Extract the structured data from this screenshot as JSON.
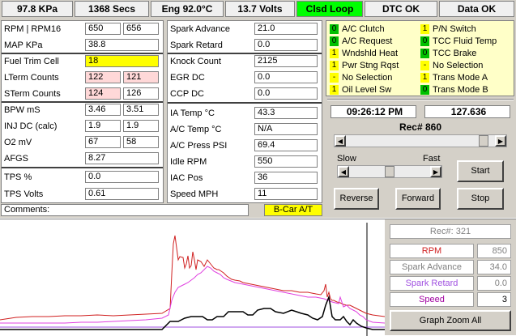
{
  "topbar": {
    "kpa": "97.8 KPa",
    "secs": "1368 Secs",
    "eng_temp": "Eng  92.0°C",
    "volts": "13.7 Volts",
    "loop": "Clsd Loop",
    "dtc": "DTC OK",
    "data": "Data OK"
  },
  "left": {
    "rpm_label": "RPM   |  RPM16",
    "rpm_v1": "650",
    "rpm_v2": "656",
    "map_label": "MAP KPa",
    "map_v": "38.8",
    "fuel_label": "Fuel Trim Cell",
    "fuel_v": "18",
    "lterm_label": "LTerm Counts",
    "lterm_v1": "122",
    "lterm_v2": "121",
    "sterm_label": "STerm Counts",
    "sterm_v1": "124",
    "sterm_v2": "126",
    "bpw_label": "BPW  mS",
    "bpw_v1": "3.46",
    "bpw_v2": "3.51",
    "inj_label": "INJ DC (calc)",
    "inj_v1": "1.9",
    "inj_v2": "1.9",
    "o2_label": "O2 mV",
    "o2_v1": "67",
    "o2_v2": "58",
    "afgs_label": "AFGS",
    "afgs_v": "8.27",
    "tps_label": "TPS %",
    "tps_v": "0.0",
    "tpsv_label": "TPS Volts",
    "tpsv_v": "0.61"
  },
  "mid": {
    "spark_adv_label": "Spark Advance",
    "spark_adv_v": "21.0",
    "spark_ret_label": "Spark Retard",
    "spark_ret_v": "0.0",
    "knock_label": "Knock Count",
    "knock_v": "2125",
    "egr_label": "EGR DC",
    "egr_v": "0.0",
    "ccp_label": "CCP DC",
    "ccp_v": "0.0",
    "ia_label": "IA Temp °C",
    "ia_v": "43.3",
    "ac_temp_label": "A/C Temp °C",
    "ac_temp_v": "N/A",
    "ac_press_label": "A/C Press PSI",
    "ac_press_v": "69.4",
    "idle_label": "Idle RPM",
    "idle_v": "550",
    "iac_label": "IAC Pos",
    "iac_v": "36",
    "speed_label": "Speed MPH",
    "speed_v": "11"
  },
  "comments": {
    "label": "Comments:",
    "tag": "B-Car A/T"
  },
  "indicators": [
    {
      "val": "0",
      "label": "A/C Clutch",
      "state": "off"
    },
    {
      "val": "1",
      "label": "P/N Switch",
      "state": "on"
    },
    {
      "val": "0",
      "label": "A/C Request",
      "state": "off"
    },
    {
      "val": "0",
      "label": "TCC Fluid Temp",
      "state": "off"
    },
    {
      "val": "1",
      "label": "Wndshld Heat",
      "state": "on"
    },
    {
      "val": "0",
      "label": "TCC Brake",
      "state": "off"
    },
    {
      "val": "1",
      "label": "Pwr Stng Rqst",
      "state": "on"
    },
    {
      "val": "-",
      "label": "No Selection",
      "state": "on"
    },
    {
      "val": "-",
      "label": "No Selection",
      "state": "on"
    },
    {
      "val": "1",
      "label": "Trans Mode A",
      "state": "on"
    },
    {
      "val": "1",
      "label": "Oil Level Sw",
      "state": "on"
    },
    {
      "val": "0",
      "label": "Trans Mode B",
      "state": "off"
    }
  ],
  "playback": {
    "time": "09:26:12 PM",
    "elapsed": "127.636",
    "rec": "Rec# 860",
    "slow": "Slow",
    "fast": "Fast",
    "start": "Start",
    "reverse": "Reverse",
    "forward": "Forward",
    "stop": "Stop"
  },
  "graph_panel": {
    "rec": "Rec#:  321",
    "rpm_label": "RPM",
    "rpm_v": "850",
    "spark_adv_label": "Spark Advance",
    "spark_adv_v": "34.0",
    "spark_ret_label": "Spark Retard",
    "spark_ret_v": "0.0",
    "speed_label": "Speed",
    "speed_v": "3",
    "zoom": "Graph Zoom All"
  },
  "colors": {
    "rpm": "#d02020",
    "spark_advance": "#e040e0",
    "spark_retard": "#a050e0",
    "speed": "#000000",
    "loop_green": "#00ff00",
    "fuel_yellow": "#ffff00",
    "pink": "#ffd8d8"
  }
}
